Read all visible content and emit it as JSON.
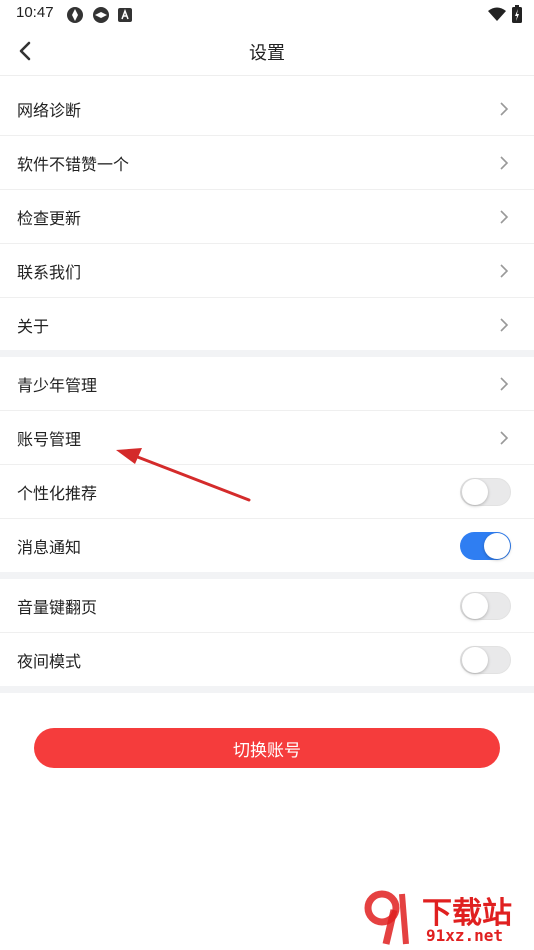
{
  "status_bar": {
    "time": "10:47",
    "left_icons": [
      "sync-icon",
      "sync-icon",
      "notification-a-icon"
    ],
    "right_icons": [
      "wifi-icon",
      "battery-charging-icon"
    ]
  },
  "header": {
    "title": "设置",
    "back_icon": "chevron-left-icon"
  },
  "groups": [
    {
      "items": [
        {
          "label": "网络诊断",
          "type": "link"
        },
        {
          "label": "软件不错赞一个",
          "type": "link"
        },
        {
          "label": "检查更新",
          "type": "link"
        },
        {
          "label": "联系我们",
          "type": "link"
        },
        {
          "label": "关于",
          "type": "link"
        }
      ]
    },
    {
      "items": [
        {
          "label": "青少年管理",
          "type": "link"
        },
        {
          "label": "账号管理",
          "type": "link"
        },
        {
          "label": "个性化推荐",
          "type": "toggle",
          "on": false
        },
        {
          "label": "消息通知",
          "type": "toggle",
          "on": true
        }
      ]
    },
    {
      "items": [
        {
          "label": "音量键翻页",
          "type": "toggle",
          "on": false
        },
        {
          "label": "夜间模式",
          "type": "toggle",
          "on": false
        }
      ]
    }
  ],
  "switch_account_button": "切换账号",
  "colors": {
    "accent_red": "#f53c3c",
    "toggle_on": "#2f7ef2",
    "toggle_off": "#e9e9ea",
    "divider": "#f2f3f5",
    "annotation_arrow": "#d42b2b"
  },
  "watermark": {
    "brand": "下载站",
    "domain": "91xz.net"
  }
}
